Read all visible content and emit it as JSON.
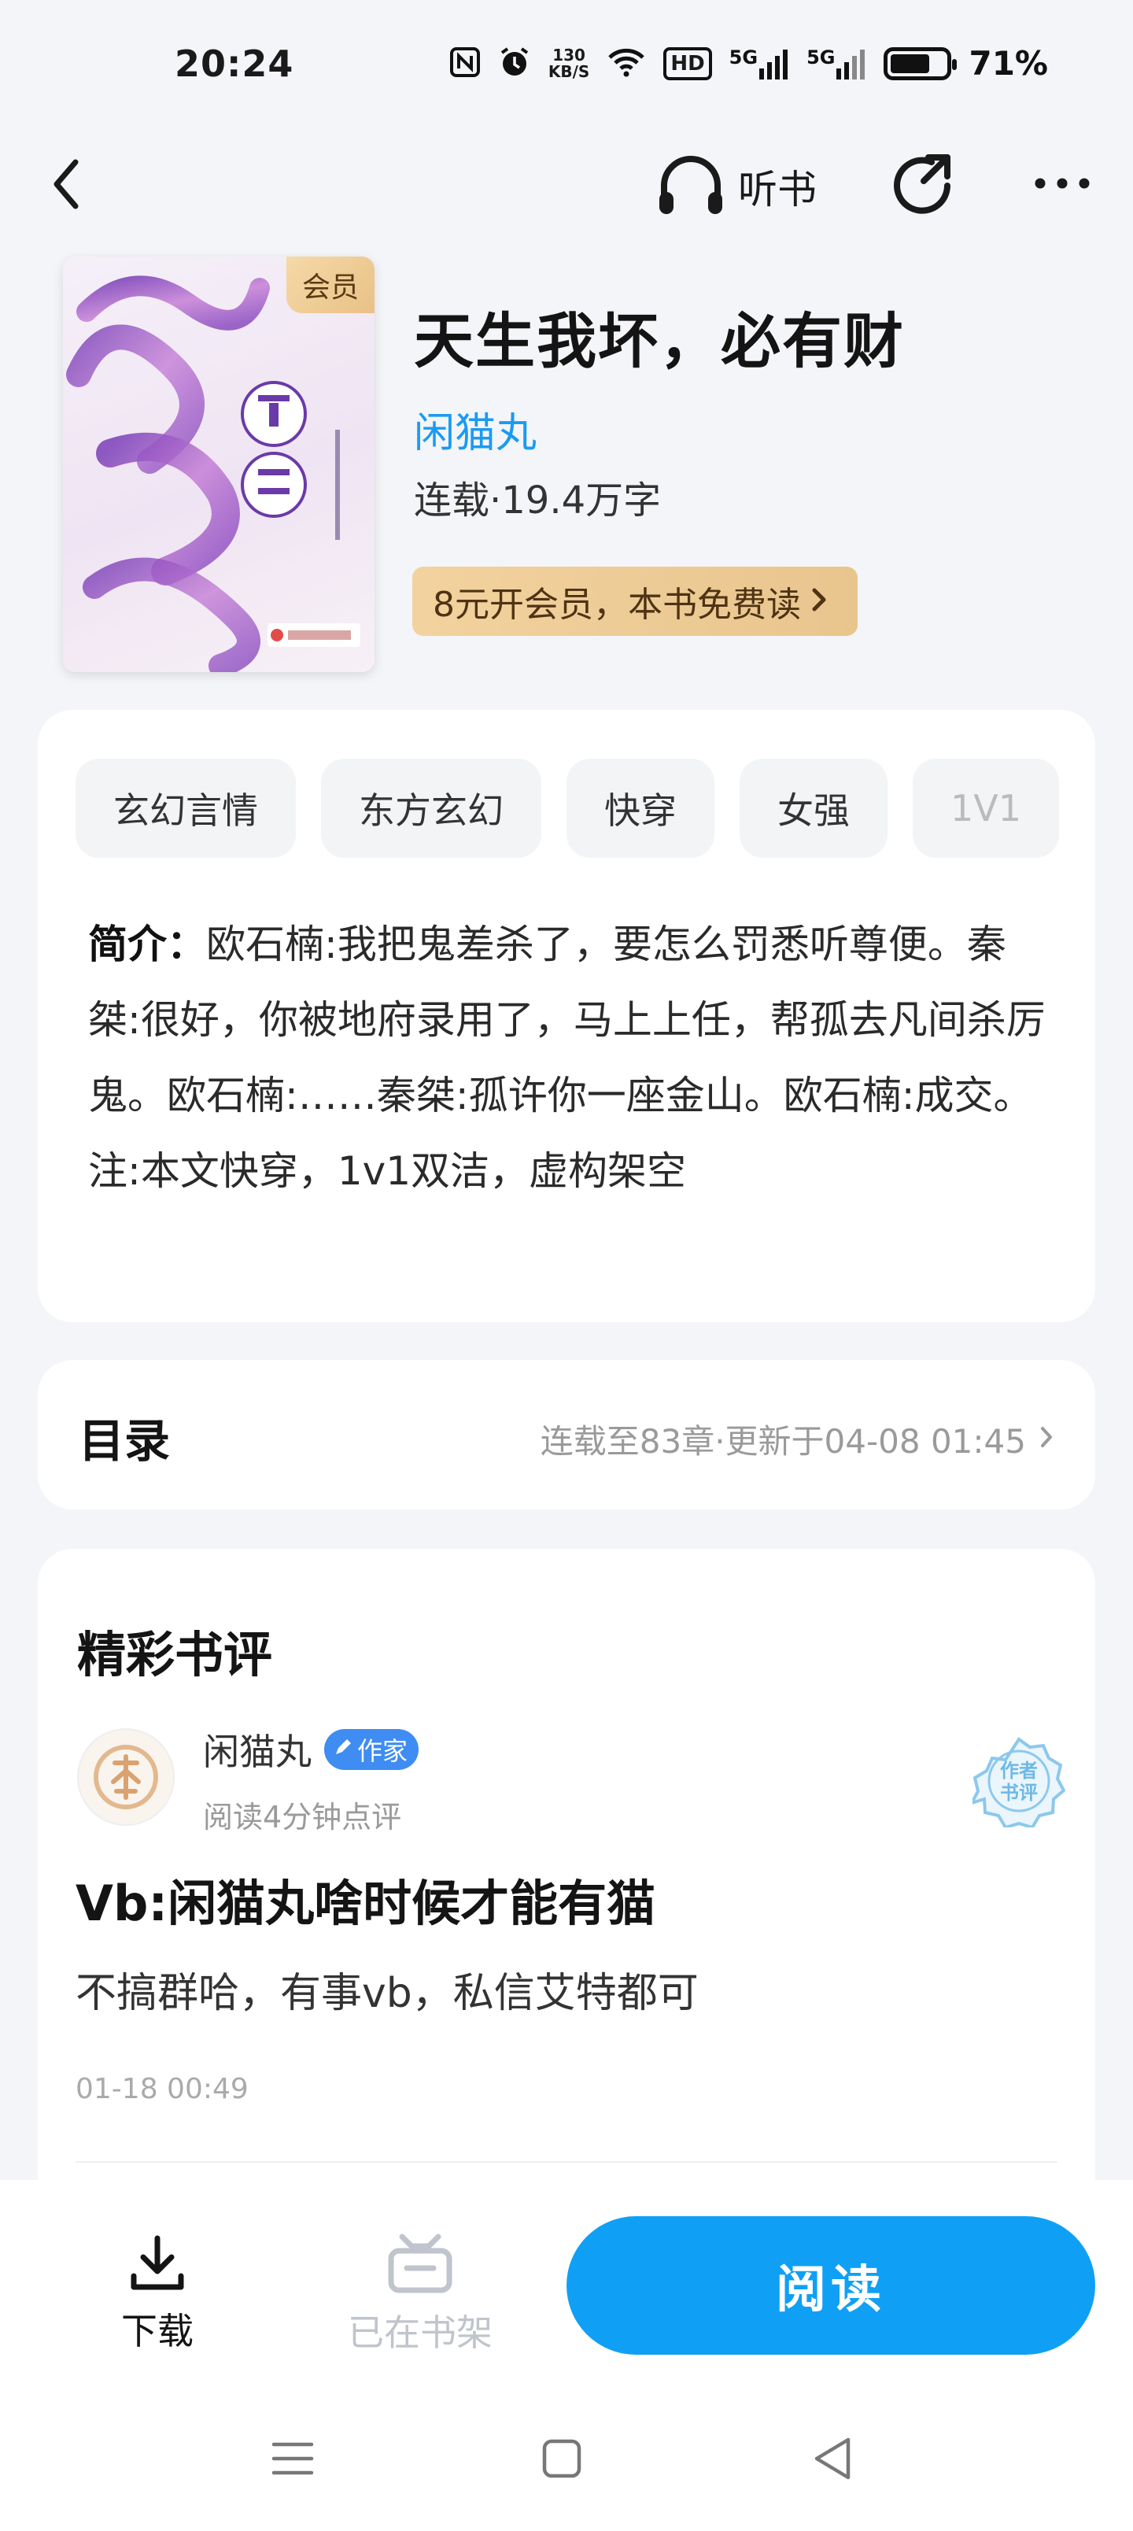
{
  "status_bar": {
    "time": "20:24",
    "nfc_icon": "nfc-icon",
    "alarm_icon": "alarm-icon",
    "net_speed_value": "130",
    "net_speed_unit": "KB/S",
    "hd_label": "HD",
    "signal_label_1": "5G",
    "signal_label_2": "5G",
    "battery_percent": "71%",
    "battery_level": 0.71
  },
  "nav": {
    "back_icon": "chevron-left-icon",
    "listen_label": "听书",
    "share_icon": "share-icon",
    "more_icon": "more-icon"
  },
  "book": {
    "vip_badge": "会员",
    "title": "天生我坏，必有财",
    "author": "闲猫丸",
    "meta": "连载·19.4万字",
    "vip_offer": "8元开会员，本书免费读"
  },
  "tags": [
    "玄幻言情",
    "东方玄幻",
    "快穿",
    "女强",
    "1V1"
  ],
  "intro": {
    "label": "简介：",
    "text": "欧石楠:我把鬼差杀了，要怎么罚悉听尊便。秦桀:很好，你被地府录用了，马上上任，帮孤去凡间杀厉鬼。欧石楠:……秦桀:孤许你一座金山。欧石楠:成交。注:本文快穿，1v1双洁，虚构架空"
  },
  "toc": {
    "title": "目录",
    "status": "连载至83章·更新于04-08 01:45"
  },
  "reviews": {
    "heading": "精彩书评",
    "item": {
      "user": "闲猫丸",
      "badge": "作家",
      "sub": "阅读4分钟点评",
      "stamp_line1": "作者",
      "stamp_line2": "书评",
      "title": "Vb:闲猫丸啥时候才能有猫",
      "body": "不搞群哈，有事vb，私信艾特都可",
      "date": "01-18 00:49"
    }
  },
  "bottom": {
    "download_label": "下载",
    "shelf_label": "已在书架",
    "read_label": "阅读"
  },
  "colors": {
    "accent": "#0fa0f5",
    "author_link": "#1a9bf2",
    "vip_gold": "#e9c58e"
  }
}
